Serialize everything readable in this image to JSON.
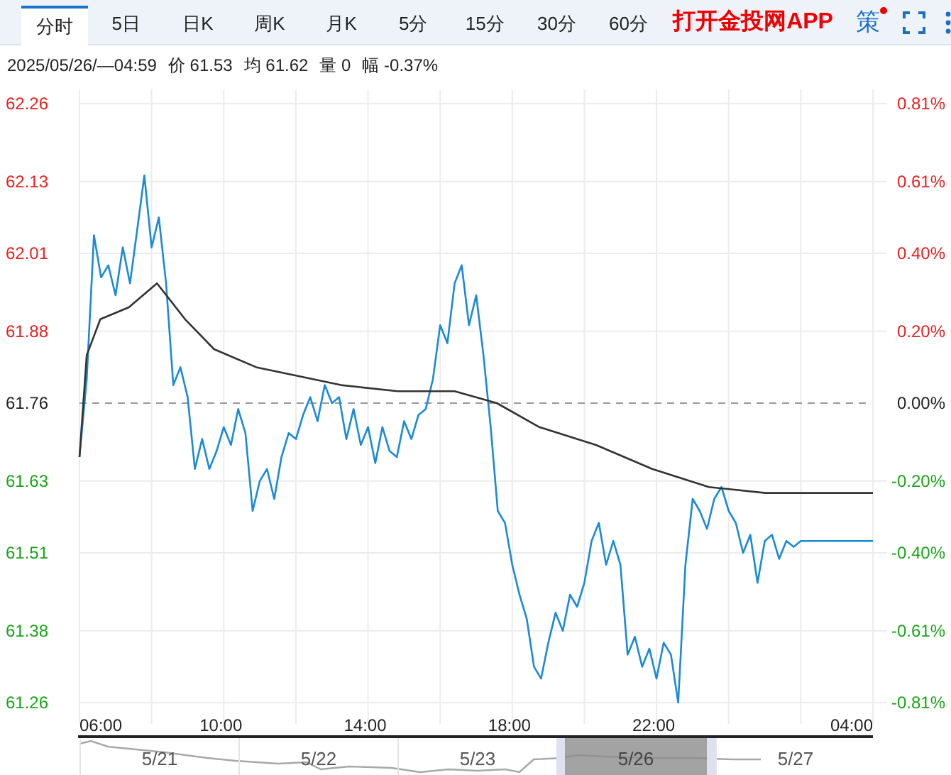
{
  "tabs": [
    {
      "label": "分时",
      "selected": true
    },
    {
      "label": "5日",
      "selected": false
    },
    {
      "label": "日K",
      "selected": false
    },
    {
      "label": "周K",
      "selected": false
    },
    {
      "label": "月K",
      "selected": false
    },
    {
      "label": "5分",
      "selected": false
    },
    {
      "label": "15分",
      "selected": false
    },
    {
      "label": "30分",
      "selected": false
    },
    {
      "label": "60分",
      "selected": false
    }
  ],
  "app_link": "打开金投网APP",
  "strategy_button": {
    "label": "策",
    "badge": true
  },
  "info": {
    "time": "2025/05/26/—04:59",
    "items": [
      {
        "label": "价",
        "value": "61.53"
      },
      {
        "label": "均",
        "value": "61.62"
      },
      {
        "label": "量",
        "value": "0"
      },
      {
        "label": "幅",
        "value": "-0.37%"
      }
    ]
  },
  "chart": {
    "percent_labels": [
      "0.81%",
      "0.61%",
      "0.40%",
      "0.20%",
      "0.00%",
      "-0.20%",
      "-0.40%",
      "-0.61%",
      "-0.81%"
    ],
    "end_time_label": "04:00",
    "chart_data": {
      "type": "line",
      "grid": true,
      "ref_lines": [
        {
          "axis": "y",
          "value": 61.76
        }
      ],
      "xlim": [
        6,
        28
      ],
      "ylim": [
        61.26,
        62.26
      ],
      "xticks": [
        {
          "value": 6,
          "label": "06:00"
        },
        {
          "value": 10,
          "label": "10:00"
        },
        {
          "value": 14,
          "label": "14:00"
        },
        {
          "value": 18,
          "label": "18:00"
        },
        {
          "value": 22,
          "label": "22:00"
        }
      ],
      "yticks": [
        {
          "value": 62.26,
          "label": "62.26"
        },
        {
          "value": 62.13,
          "label": "62.13"
        },
        {
          "value": 62.01,
          "label": "62.01"
        },
        {
          "value": 61.88,
          "label": "61.88"
        },
        {
          "value": 61.76,
          "label": "61.76"
        },
        {
          "value": 61.63,
          "label": "61.63"
        },
        {
          "value": 61.51,
          "label": "61.51"
        },
        {
          "value": 61.38,
          "label": "61.38"
        },
        {
          "value": 61.26,
          "label": "61.26"
        }
      ],
      "series": [
        {
          "color": "#1a8ad6",
          "x": [
            6,
            6.2,
            6.4,
            6.6,
            6.8,
            7,
            7.2,
            7.4,
            7.6,
            7.8,
            8,
            8.2,
            8.4,
            8.6,
            8.8,
            9,
            9.2,
            9.4,
            9.6,
            9.8,
            10,
            10.2,
            10.4,
            10.6,
            10.8,
            11,
            11.2,
            11.4,
            11.6,
            11.8,
            12,
            12.2,
            12.4,
            12.6,
            12.8,
            13,
            13.2,
            13.4,
            13.6,
            13.8,
            14,
            14.2,
            14.4,
            14.6,
            14.8,
            15,
            15.2,
            15.4,
            15.6,
            15.8,
            16,
            16.2,
            16.4,
            16.6,
            16.8,
            17,
            17.2,
            17.4,
            17.6,
            17.8,
            18,
            18.2,
            18.4,
            18.6,
            18.8,
            19,
            19.2,
            19.4,
            19.6,
            19.8,
            20,
            20.2,
            20.4,
            20.6,
            20.8,
            21,
            21.2,
            21.4,
            21.6,
            21.8,
            22,
            22.2,
            22.4,
            22.6,
            22.8,
            23,
            23.2,
            23.4,
            23.6,
            23.8,
            24,
            24.2,
            24.4,
            24.6,
            24.8,
            25,
            25.2,
            25.4,
            25.6,
            25.8,
            26,
            28
          ],
          "values": [
            61.67,
            61.8,
            62.04,
            61.97,
            61.99,
            61.94,
            62.02,
            61.96,
            62.05,
            62.14,
            62.02,
            62.07,
            61.96,
            61.79,
            61.82,
            61.77,
            61.65,
            61.7,
            61.65,
            61.68,
            61.72,
            61.69,
            61.75,
            61.71,
            61.58,
            61.63,
            61.65,
            61.6,
            61.67,
            61.71,
            61.7,
            61.74,
            61.77,
            61.73,
            61.79,
            61.76,
            61.77,
            61.7,
            61.75,
            61.69,
            61.72,
            61.66,
            61.72,
            61.68,
            61.67,
            61.73,
            61.7,
            61.74,
            61.75,
            61.8,
            61.89,
            61.86,
            61.96,
            61.99,
            61.89,
            61.94,
            61.84,
            61.72,
            61.58,
            61.56,
            61.49,
            61.44,
            61.4,
            61.32,
            61.3,
            61.36,
            61.41,
            61.38,
            61.44,
            61.42,
            61.46,
            61.53,
            61.56,
            61.49,
            61.53,
            61.49,
            61.34,
            61.37,
            61.32,
            61.35,
            61.3,
            61.36,
            61.34,
            61.26,
            61.49,
            61.6,
            61.58,
            61.55,
            61.6,
            61.62,
            61.58,
            61.56,
            61.51,
            61.54,
            61.46,
            61.53,
            61.54,
            61.5,
            61.53,
            61.52,
            61.53,
            61.53
          ]
        },
        {
          "color": "#333333",
          "x": [
            6,
            6.2,
            6.58,
            7.37,
            8.15,
            8.93,
            9.73,
            10.9,
            11.68,
            13.25,
            14.82,
            16.4,
            17.57,
            18.75,
            20.32,
            21.88,
            23.45,
            25.02,
            28
          ],
          "values": [
            61.67,
            61.84,
            61.9,
            61.92,
            61.96,
            61.9,
            61.85,
            61.82,
            61.81,
            61.79,
            61.78,
            61.78,
            61.76,
            61.72,
            61.69,
            61.65,
            61.62,
            61.61,
            61.61
          ]
        }
      ]
    }
  },
  "navigator": {
    "days": [
      {
        "label": "5/21",
        "selected": false
      },
      {
        "label": "5/22",
        "selected": false
      },
      {
        "label": "5/23",
        "selected": false
      },
      {
        "label": "5/26",
        "selected": true
      },
      {
        "label": "5/27",
        "selected": false
      }
    ]
  }
}
